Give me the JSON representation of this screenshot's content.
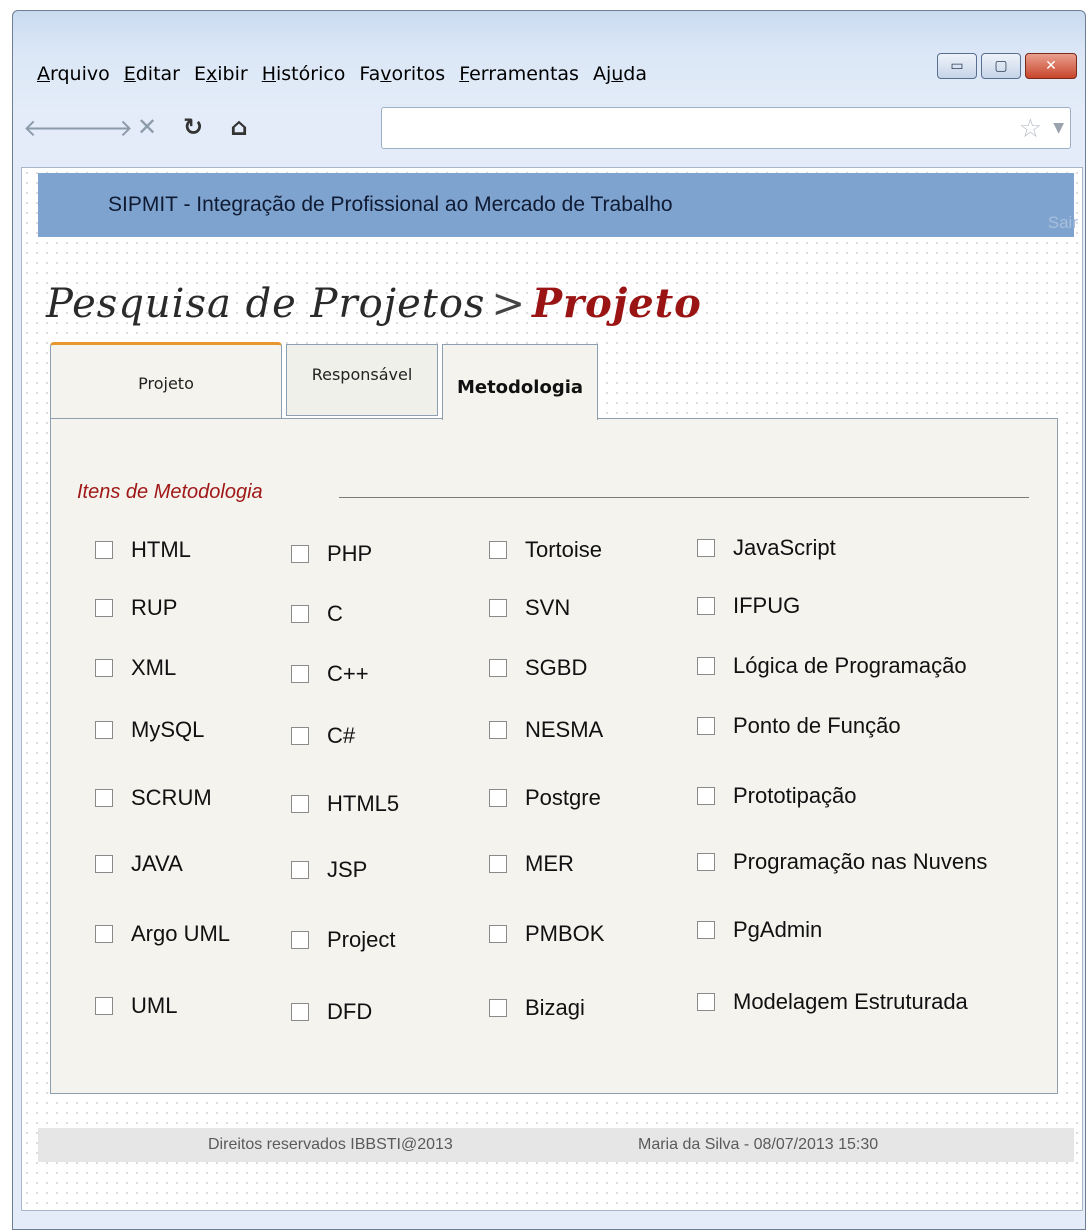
{
  "browser": {
    "menu": [
      {
        "label": "Arquivo",
        "accel_index": 0
      },
      {
        "label": "Editar",
        "accel_index": 0
      },
      {
        "label": "Exibir",
        "accel_index": 1
      },
      {
        "label": "Histórico",
        "accel_index": 0
      },
      {
        "label": "Favoritos",
        "accel_index": 2
      },
      {
        "label": "Ferramentas",
        "accel_index": 0
      },
      {
        "label": "Ajuda",
        "accel_index": 2
      }
    ],
    "nav_icons": [
      "back-icon",
      "forward-icon",
      "stop-icon",
      "reload-icon",
      "home-icon"
    ],
    "url_value": ""
  },
  "app": {
    "header_title": "SIPMIT - Integração de Profissional ao Mercado de Trabalho",
    "logout_label": "Sair",
    "breadcrumb": {
      "parent": "Pesquisa de Projetos",
      "separator": ">",
      "current": "Projeto"
    },
    "tabs": [
      {
        "label": "Projeto",
        "active": false
      },
      {
        "label": "Responsável",
        "active": false
      },
      {
        "label": "Metodologia",
        "active": true
      }
    ],
    "section_title": "Itens de Metodologia",
    "items": {
      "col1": [
        "HTML",
        "RUP",
        "XML",
        "MySQL",
        "SCRUM",
        "JAVA",
        "Argo UML",
        "UML"
      ],
      "col2": [
        "PHP",
        "C",
        "C++",
        "C#",
        "HTML5",
        "JSP",
        "Project",
        "DFD"
      ],
      "col3": [
        "Tortoise",
        "SVN",
        "SGBD",
        "NESMA",
        "Postgre",
        "MER",
        "PMBOK",
        "Bizagi"
      ],
      "col4": [
        "JavaScript",
        "IFPUG",
        "Lógica de Programação",
        "Ponto de Função",
        "Prototipação",
        "Programação nas Nuvens",
        "PgAdmin",
        "Modelagem Estruturada"
      ]
    },
    "footer": {
      "copyright": "Direitos reservados IBBSTI@2013",
      "user_info": "Maria da Silva - 08/07/2013 15:30"
    }
  }
}
